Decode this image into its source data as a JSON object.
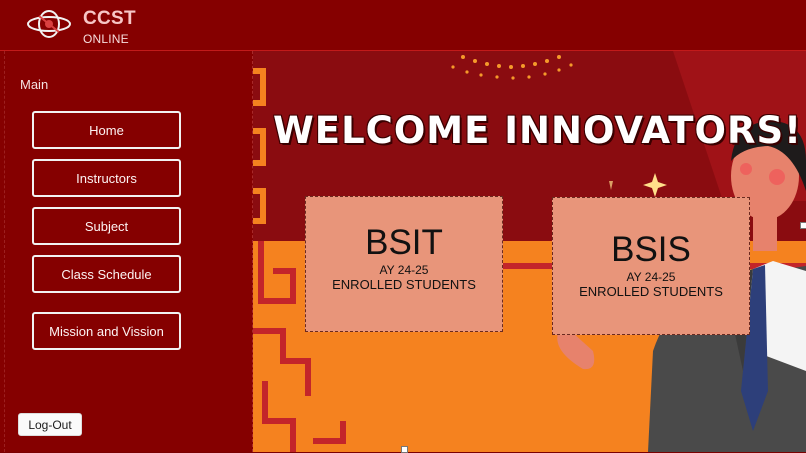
{
  "header": {
    "brand_title": "CCST",
    "brand_subtitle": "ONLINE",
    "logo_icon": "atom-ring-logo-icon"
  },
  "sidebar": {
    "section_label": "Main",
    "items": [
      {
        "label": "Home"
      },
      {
        "label": "Instructors"
      },
      {
        "label": "Subject"
      },
      {
        "label": "Class Schedule"
      },
      {
        "label": "Mission and Vission"
      }
    ],
    "logout_label": "Log-Out"
  },
  "main": {
    "welcome_text": "WELCOME INNOVATORS!",
    "cards": [
      {
        "title": "BSIT",
        "year": "AY 24-25",
        "caption": "ENROLLED STUDENTS"
      },
      {
        "title": "BSIS",
        "year": "AY 24-25",
        "caption": "ENROLLED STUDENTS"
      }
    ]
  },
  "colors": {
    "header_bg": "#850000",
    "sidebar_bg": "#850000",
    "banner_red": "#8a0c10",
    "banner_orange": "#f5821f",
    "card_bg": "#e8957a",
    "button_border": "#f2f2f2"
  }
}
